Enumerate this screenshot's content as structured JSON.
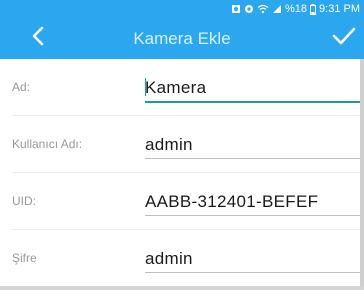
{
  "status_bar": {
    "signal_text": "%18",
    "time": "9:31 PM"
  },
  "toolbar": {
    "title": "Kamera Ekle",
    "back_icon": "chevron-left",
    "confirm_icon": "checkmark"
  },
  "form": {
    "fields": [
      {
        "label": "Ad:",
        "value": "Kamera"
      },
      {
        "label": "Kullanıcı Adı:",
        "value": "admin"
      },
      {
        "label": "UID:",
        "value": "AABB-312401-BEFEF"
      },
      {
        "label": "Şifre",
        "value": "admin"
      }
    ]
  },
  "colors": {
    "header": "#2aa7ee",
    "accent": "#1e9e93",
    "label": "#9a9a9a"
  }
}
